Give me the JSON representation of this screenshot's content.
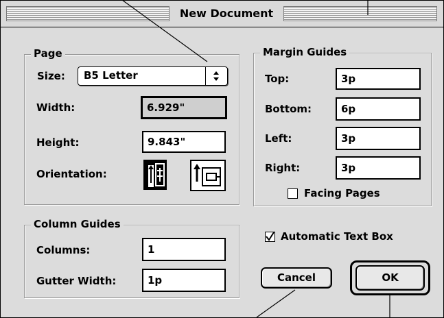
{
  "window": {
    "title": "New Document"
  },
  "page_group": {
    "title": "Page",
    "size_label": "Size:",
    "size_value": "B5 Letter",
    "width_label": "Width:",
    "width_value": "6.929\"",
    "height_label": "Height:",
    "height_value": "9.843\"",
    "orientation_label": "Orientation:",
    "orientation_selected": "portrait"
  },
  "margin_group": {
    "title": "Margin Guides",
    "top_label": "Top:",
    "top_value": "3p",
    "bottom_label": "Bottom:",
    "bottom_value": "6p",
    "left_label": "Left:",
    "left_value": "3p",
    "right_label": "Right:",
    "right_value": "3p",
    "facing_pages_label": "Facing Pages",
    "facing_pages_checked": false
  },
  "column_group": {
    "title": "Column Guides",
    "columns_label": "Columns:",
    "columns_value": "1",
    "gutter_label": "Gutter Width:",
    "gutter_value": "1p"
  },
  "auto_text_box": {
    "label": "Automatic Text Box",
    "checked": true
  },
  "buttons": {
    "cancel": "Cancel",
    "ok": "OK"
  },
  "icons": [
    "portrait-orientation-icon",
    "landscape-orientation-icon",
    "popup-arrows-icon",
    "checkmark-icon"
  ]
}
